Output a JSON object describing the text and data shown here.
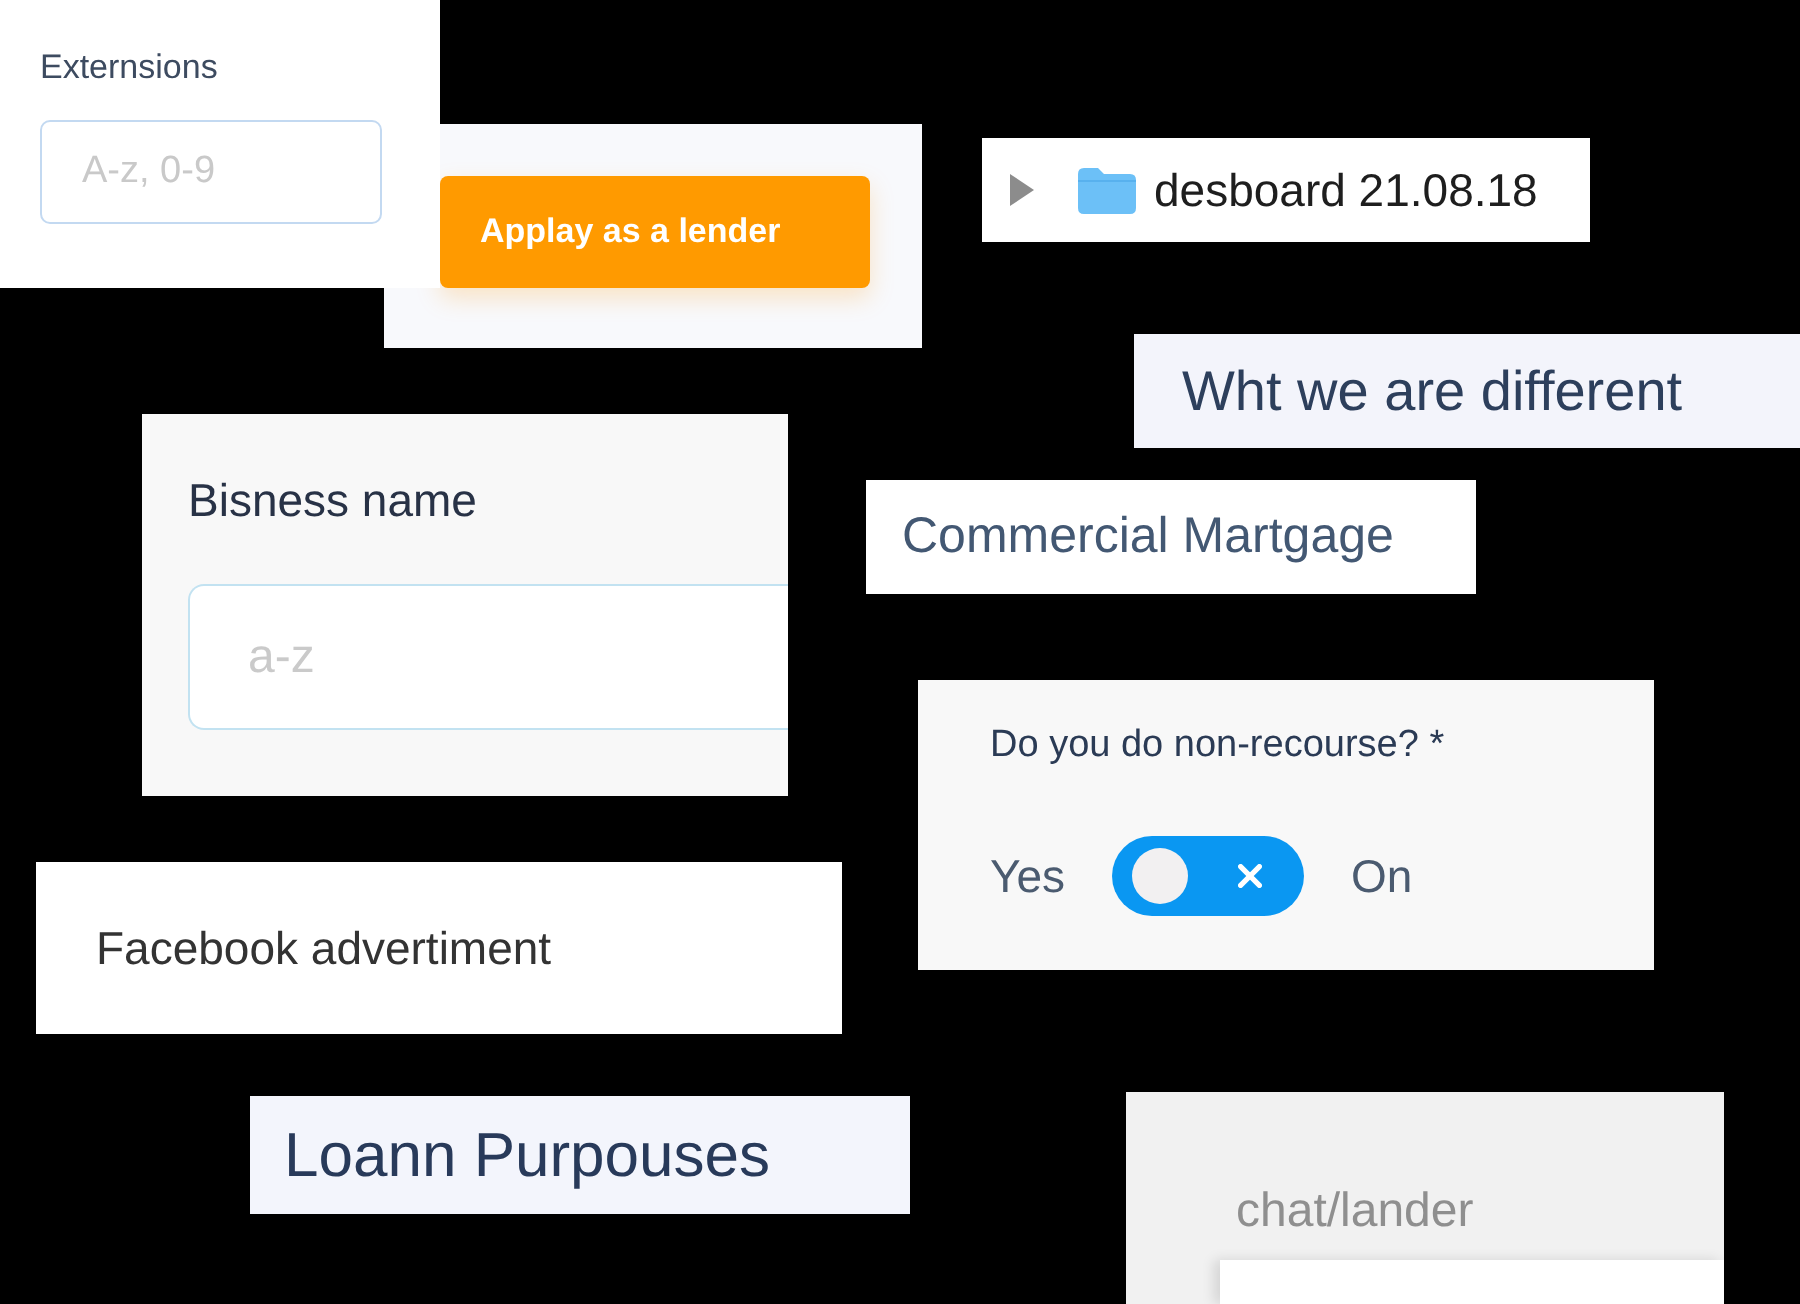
{
  "cards": [
    {
      "kind": "field",
      "label": "Externsions",
      "placeholder": "A-z, 0-9"
    },
    {
      "kind": "button",
      "label": "Applay as a lender"
    },
    {
      "kind": "tree_row",
      "expanded": false,
      "label": "desboard 21.08.18"
    },
    {
      "kind": "text",
      "text": "Wht we are different"
    },
    {
      "kind": "field",
      "label": "Bisness name",
      "placeholder": "a-z"
    },
    {
      "kind": "text",
      "text": "Commercial Martgage"
    },
    {
      "kind": "toggle",
      "question": "Do you do non-recourse? *",
      "left_label": "Yes",
      "on": false,
      "right_label": "On"
    },
    {
      "kind": "text",
      "text": "Facebook advertiment"
    },
    {
      "kind": "text",
      "text": "Loann Purpouses"
    },
    {
      "kind": "field",
      "label": "chat/lander"
    }
  ]
}
